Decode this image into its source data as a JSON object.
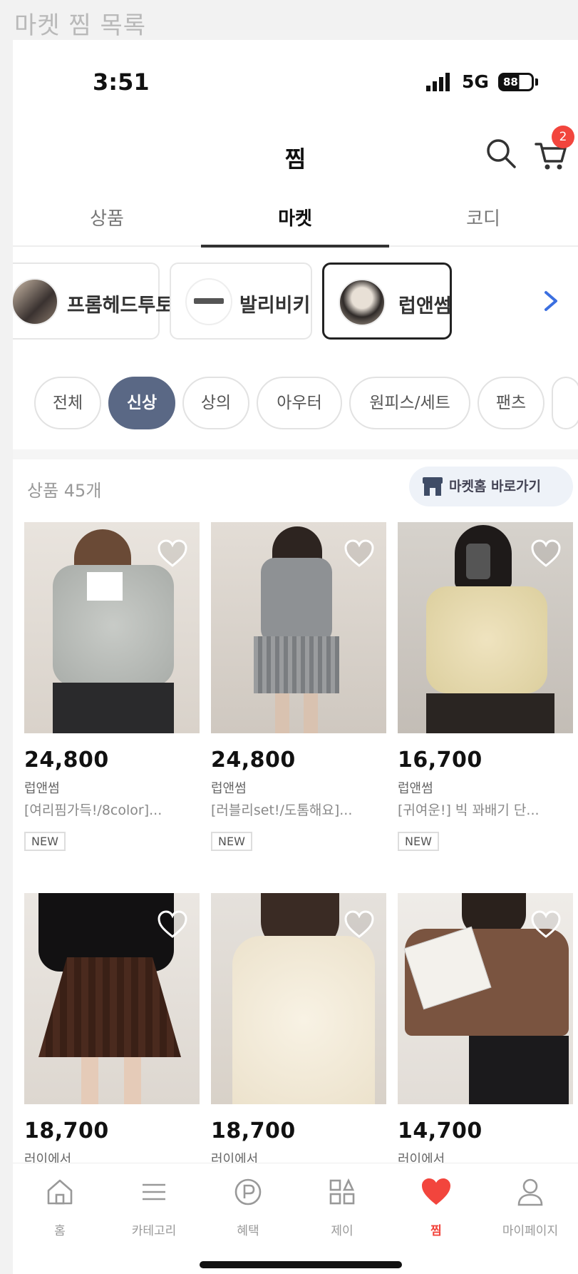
{
  "caption": "마켓 찜 목록",
  "status_bar": {
    "time": "3:51",
    "network": "5G",
    "battery": "88"
  },
  "header": {
    "title": "찜",
    "cart_count": "2"
  },
  "tabs": [
    {
      "label": "상품",
      "active": false
    },
    {
      "label": "마켓",
      "active": true
    },
    {
      "label": "코디",
      "active": false
    }
  ],
  "markets": [
    {
      "name": "프롬헤드투토",
      "selected": false
    },
    {
      "name": "발리비키",
      "selected": false
    },
    {
      "name": "럽앤썸",
      "selected": true
    }
  ],
  "filters": [
    {
      "label": "전체",
      "active": false
    },
    {
      "label": "신상",
      "active": true
    },
    {
      "label": "상의",
      "active": false
    },
    {
      "label": "아우터",
      "active": false
    },
    {
      "label": "원피스/세트",
      "active": false
    },
    {
      "label": "팬츠",
      "active": false
    }
  ],
  "product_count": "상품 45개",
  "store_link": "마켓홈 바로가기",
  "products": [
    {
      "price": "24,800",
      "seller": "럽앤썸",
      "name": "[여리핌가득!/8color]...",
      "badge": "NEW"
    },
    {
      "price": "24,800",
      "seller": "럽앤썸",
      "name": "[러블리set!/도톰해요]...",
      "badge": "NEW"
    },
    {
      "price": "16,700",
      "seller": "럽앤썸",
      "name": "[귀여운!] 빅 꽈배기 단...",
      "badge": "NEW"
    },
    {
      "price": "18,700",
      "seller": "러이에서",
      "name": "",
      "badge": ""
    },
    {
      "price": "18,700",
      "seller": "러이에서",
      "name": "",
      "badge": ""
    },
    {
      "price": "14,700",
      "seller": "러이에서",
      "name": "",
      "badge": ""
    }
  ],
  "bottom_nav": [
    {
      "label": "홈",
      "icon": "home-icon",
      "active": false
    },
    {
      "label": "카테고리",
      "icon": "menu-icon",
      "active": false
    },
    {
      "label": "혜택",
      "icon": "point-icon",
      "active": false
    },
    {
      "label": "제이",
      "icon": "style-icon",
      "active": false
    },
    {
      "label": "찜",
      "icon": "heart-icon",
      "active": true
    },
    {
      "label": "마이페이지",
      "icon": "user-icon",
      "active": false
    }
  ],
  "colors": {
    "accent": "#f2453d",
    "chip_active": "#5a6885"
  }
}
